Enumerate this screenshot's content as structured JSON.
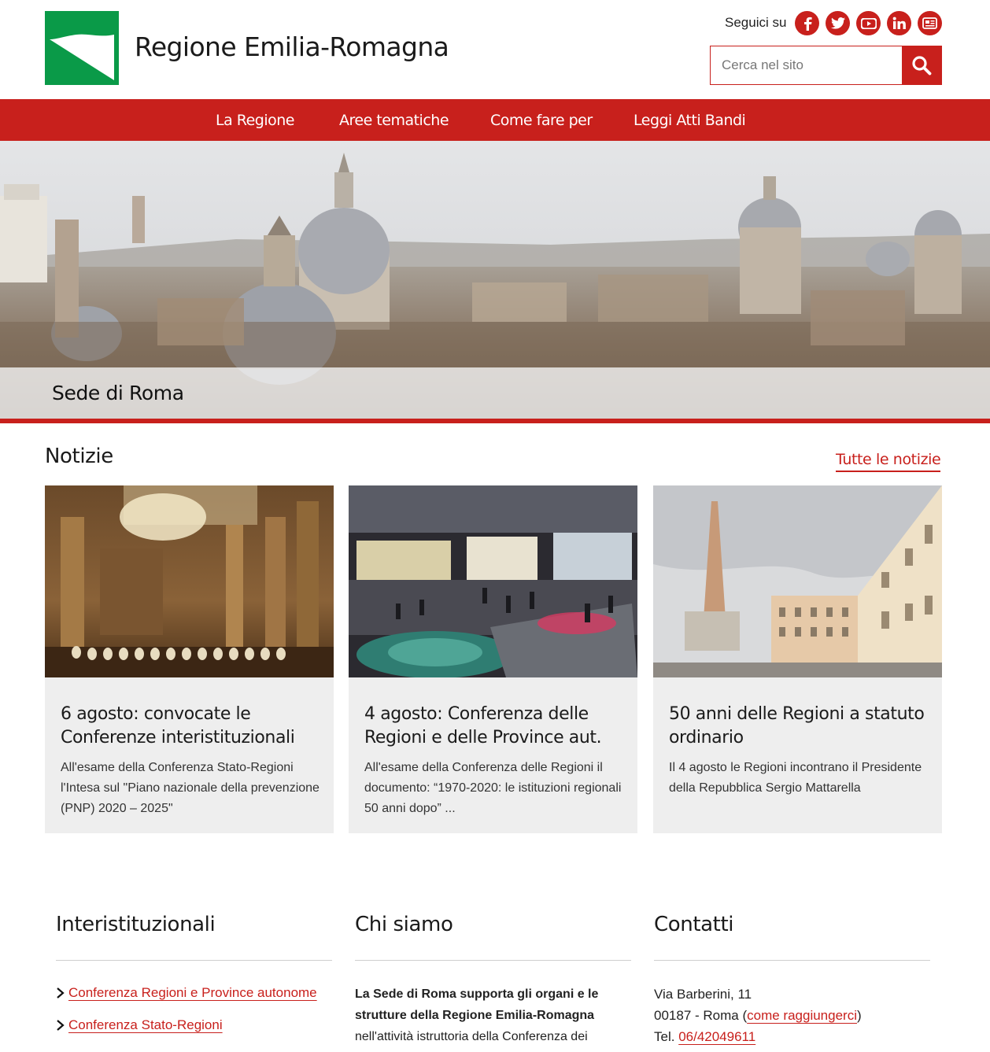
{
  "header": {
    "title": "Regione Emilia-Romagna",
    "follow_label": "Seguici su",
    "socials": [
      "facebook-icon",
      "twitter-icon",
      "youtube-icon",
      "linkedin-icon",
      "news-icon"
    ],
    "search": {
      "placeholder": "Cerca nel sito"
    }
  },
  "nav": {
    "items": [
      {
        "label": "La Regione"
      },
      {
        "label": "Aree tematiche"
      },
      {
        "label": "Come fare per"
      },
      {
        "label": "Leggi Atti Bandi"
      }
    ]
  },
  "hero": {
    "caption": "Sede di Roma"
  },
  "news": {
    "title": "Notizie",
    "all_link": "Tutte le notizie",
    "cards": [
      {
        "title": "6 agosto: convocate le Conferenze interistituzionali",
        "text": "All'esame della Conferenza Stato-Regioni l'Intesa sul \"Piano nazionale della prevenzione (PNP) 2020 – 2025\""
      },
      {
        "title": "4 agosto: Conferenza delle Regioni e delle Province aut.",
        "text": "All'esame della Conferenza delle Regioni il documento: “1970-2020: le istituzioni regionali 50 anni dopo” ..."
      },
      {
        "title": "50 anni delle Regioni a statuto ordinario",
        "text": "Il 4 agosto le Regioni incontrano il Presidente della Repubblica Sergio Mattarella"
      }
    ]
  },
  "footer": {
    "interistituzionali": {
      "title": "Interistituzionali",
      "links": [
        "Conferenza Regioni e Province autonome",
        "Conferenza Stato-Regioni"
      ]
    },
    "chi_siamo": {
      "title": "Chi siamo",
      "bold": "La Sede di Roma supporta gli organi e le strutture della Regione Emilia-Romagna",
      "text": " nell'attività istruttoria della Conferenza dei"
    },
    "contatti": {
      "title": "Contatti",
      "address": "Via Barberini, 11",
      "city": "00187 - Roma (",
      "directions_link": "come raggiungerci",
      "city_end": ")",
      "tel_label": "Tel. ",
      "tel": "06/42049611"
    }
  },
  "colors": {
    "brand_red": "#c8201c",
    "logo_green": "#0a9a48",
    "card_bg": "#eeeeee"
  }
}
